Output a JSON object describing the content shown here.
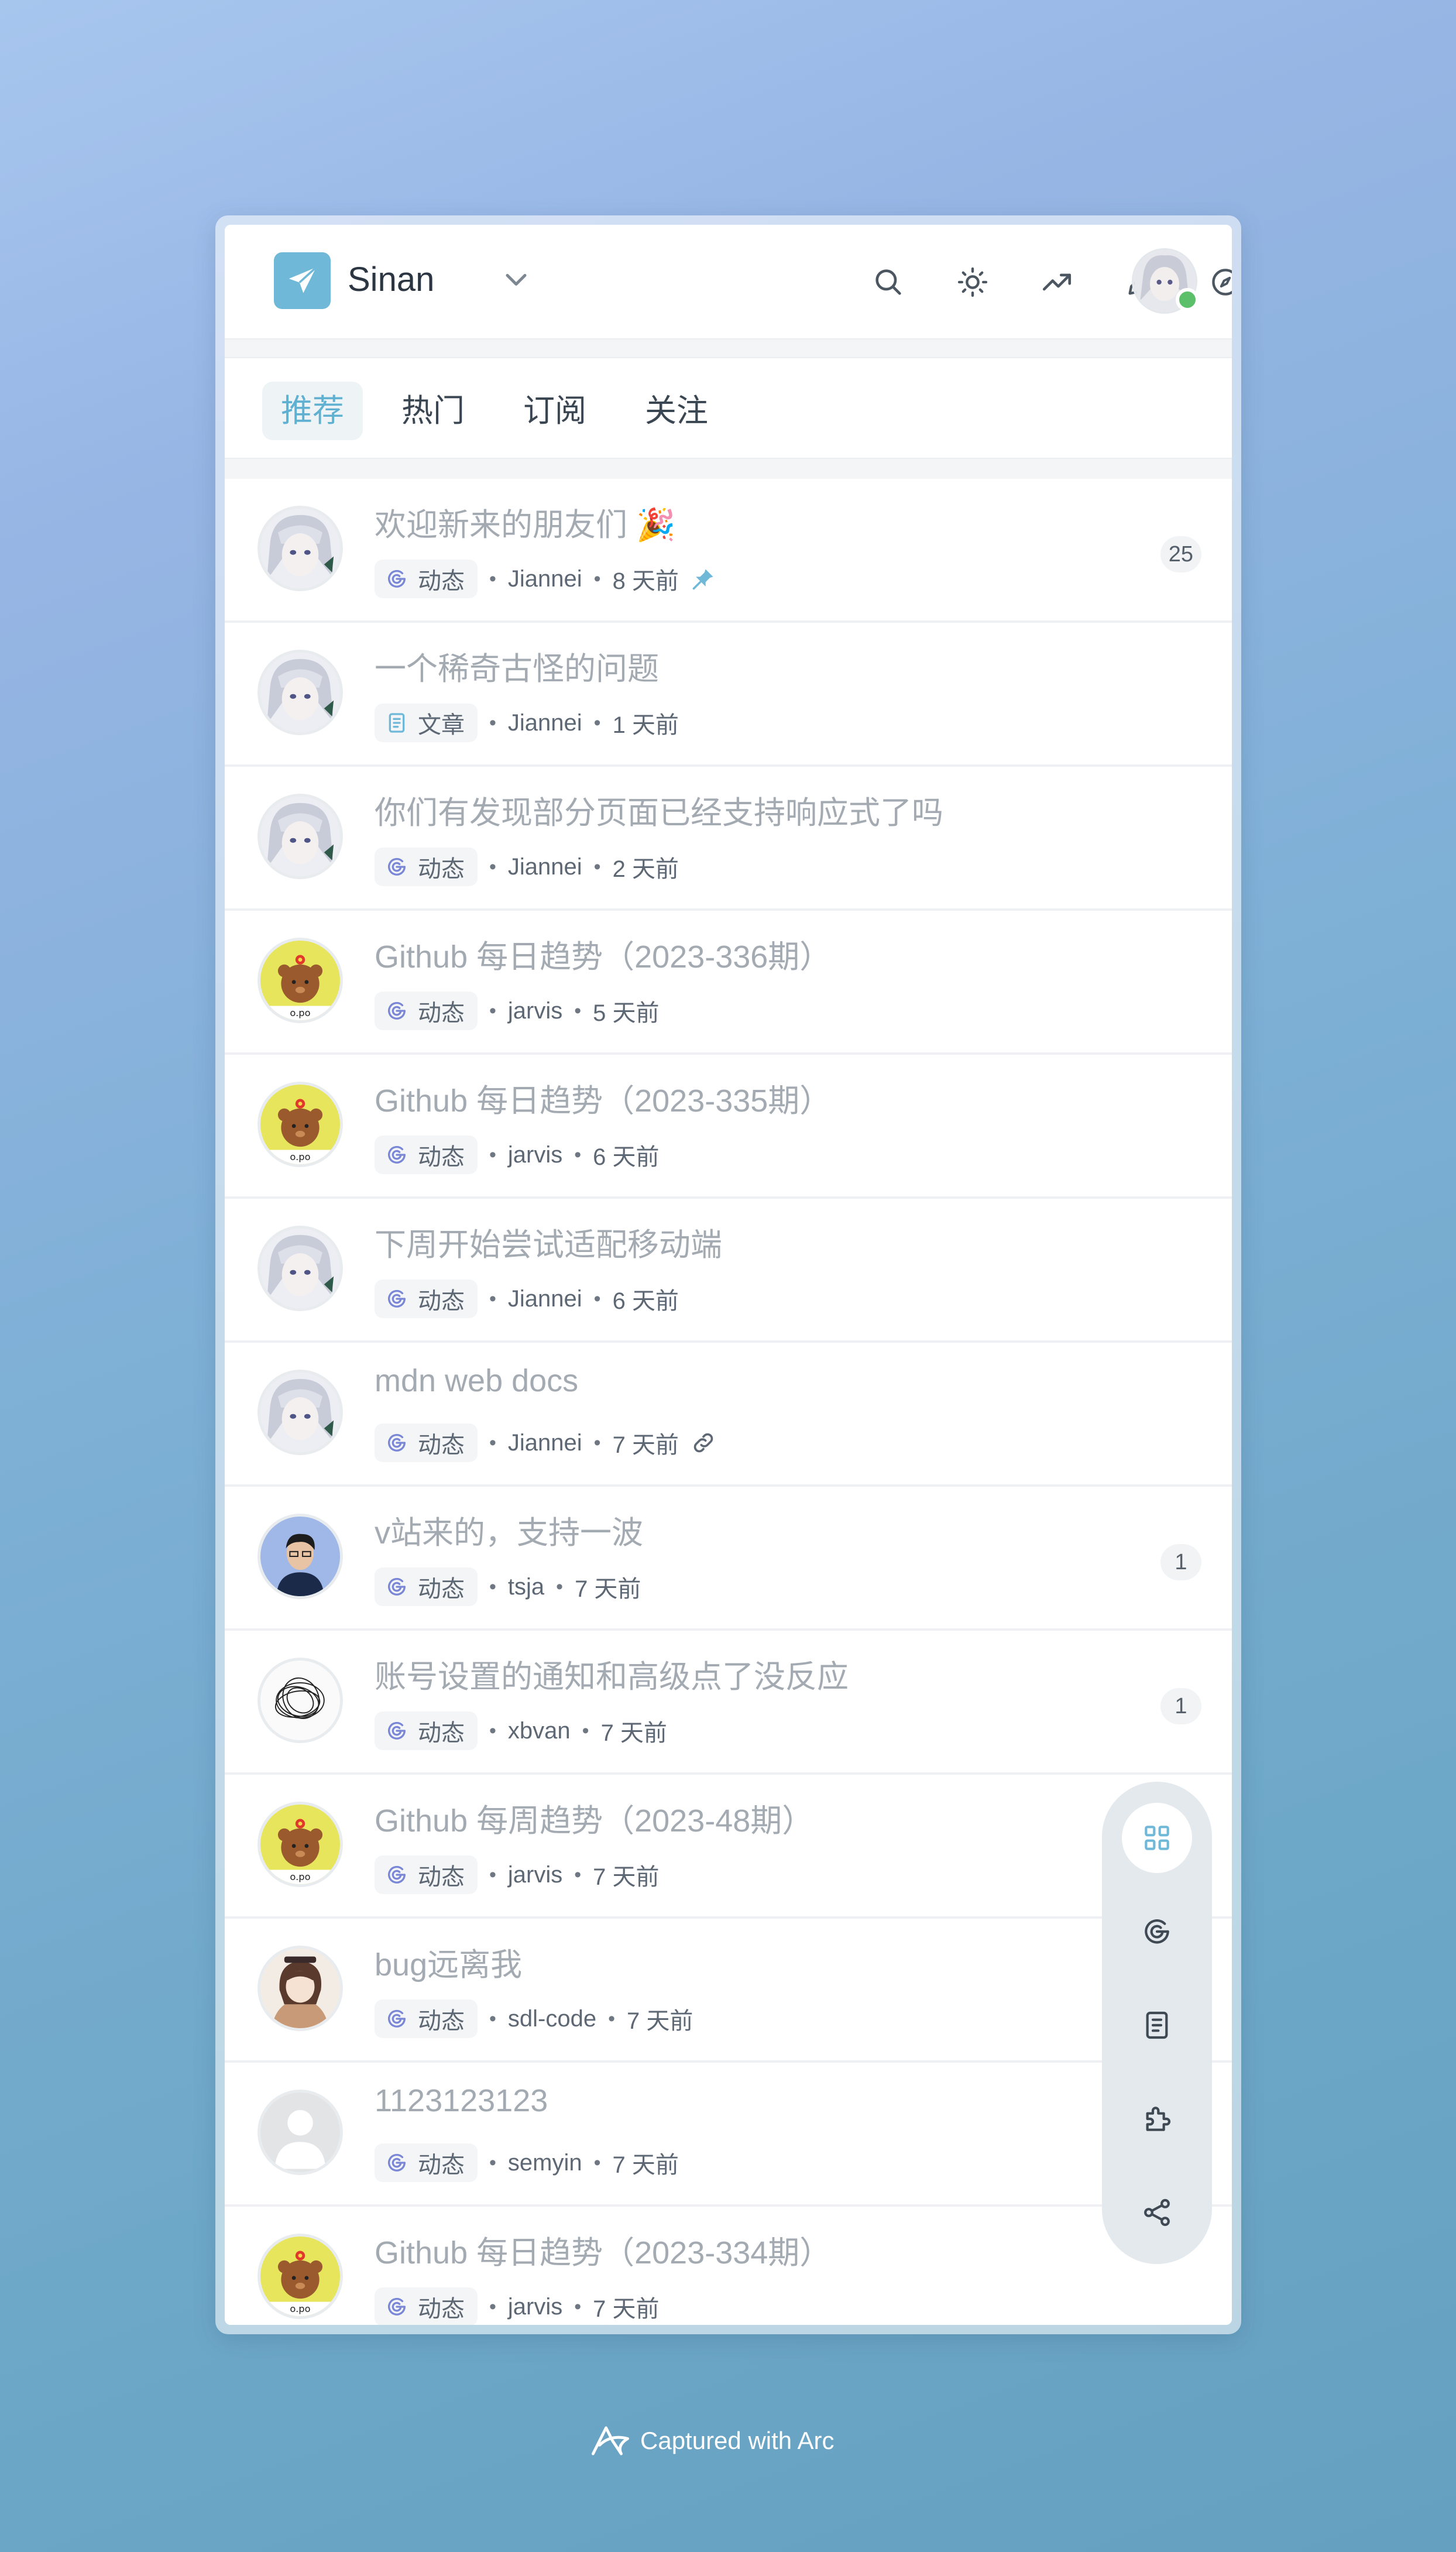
{
  "app": {
    "brand": "Sinan",
    "accent_color": "#6fb8d8",
    "header_icons": [
      "search-icon",
      "sun-icon",
      "trending-icon",
      "edit-icon",
      "compass-icon",
      "bell-icon"
    ]
  },
  "tabs": [
    {
      "label": "推荐",
      "active": true
    },
    {
      "label": "热门",
      "active": false
    },
    {
      "label": "订阅",
      "active": false
    },
    {
      "label": "关注",
      "active": false
    }
  ],
  "posts": [
    {
      "title": "欢迎新来的朋友们 🎉",
      "type": "动态",
      "author": "Jiannei",
      "time": "8 天前",
      "count": "25",
      "trail": "pin-icon",
      "avatar": "anime"
    },
    {
      "title": "一个稀奇古怪的问题",
      "type": "文章",
      "author": "Jiannei",
      "time": "1 天前",
      "count": "",
      "trail": "",
      "avatar": "anime"
    },
    {
      "title": "你们有发现部分页面已经支持响应式了吗",
      "type": "动态",
      "author": "Jiannei",
      "time": "2 天前",
      "count": "",
      "trail": "",
      "avatar": "anime"
    },
    {
      "title": "Github 每日趋势（2023-336期）",
      "type": "动态",
      "author": "jarvis",
      "time": "5 天前",
      "count": "",
      "trail": "",
      "avatar": "bear"
    },
    {
      "title": "Github 每日趋势（2023-335期）",
      "type": "动态",
      "author": "jarvis",
      "time": "6 天前",
      "count": "",
      "trail": "",
      "avatar": "bear"
    },
    {
      "title": "下周开始尝试适配移动端",
      "type": "动态",
      "author": "Jiannei",
      "time": "6 天前",
      "count": "",
      "trail": "",
      "avatar": "anime"
    },
    {
      "title": "mdn web docs",
      "type": "动态",
      "author": "Jiannei",
      "time": "7 天前",
      "count": "",
      "trail": "link-icon",
      "avatar": "anime"
    },
    {
      "title": "v站来的，支持一波",
      "type": "动态",
      "author": "tsja",
      "time": "7 天前",
      "count": "1",
      "trail": "",
      "avatar": "person"
    },
    {
      "title": "账号设置的通知和高级点了没反应",
      "type": "动态",
      "author": "xbvan",
      "time": "7 天前",
      "count": "1",
      "trail": "",
      "avatar": "scribble"
    },
    {
      "title": "Github 每周趋势（2023-48期）",
      "type": "动态",
      "author": "jarvis",
      "time": "7 天前",
      "count": "",
      "trail": "",
      "avatar": "bear"
    },
    {
      "title": "bug远离我",
      "type": "动态",
      "author": "sdl-code",
      "time": "7 天前",
      "count": "",
      "trail": "",
      "avatar": "girl"
    },
    {
      "title": "1123123123",
      "type": "动态",
      "author": "semyin",
      "time": "7 天前",
      "count": "",
      "trail": "",
      "avatar": "default"
    },
    {
      "title": "Github 每日趋势（2023-334期）",
      "type": "动态",
      "author": "jarvis",
      "time": "7 天前",
      "count": "",
      "trail": "",
      "avatar": "bear"
    }
  ],
  "sidebar": [
    "grid-icon",
    "feed-icon",
    "document-icon",
    "puzzle-icon",
    "share-icon"
  ],
  "footer": {
    "text": "Captured with Arc"
  }
}
